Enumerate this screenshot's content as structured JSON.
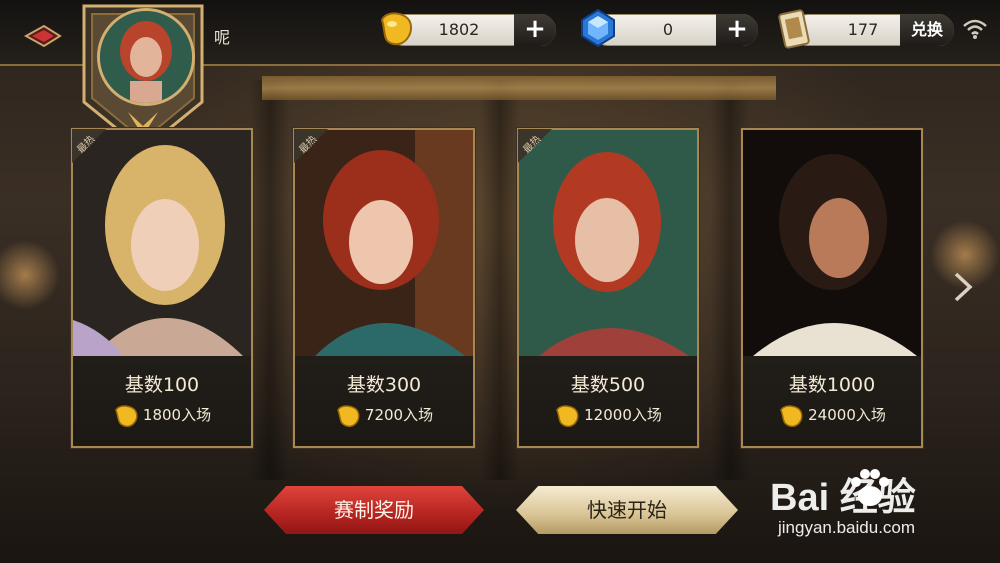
{
  "header": {
    "nickname": "呢",
    "coins": "1802",
    "gems": "0",
    "tickets": "177",
    "exchange_label": "兑换",
    "plus_label": "+"
  },
  "tiers": [
    {
      "hot_tag": "最热",
      "base": "基数100",
      "entry": "1800入场"
    },
    {
      "hot_tag": "最热",
      "base": "基数300",
      "entry": "7200入场"
    },
    {
      "hot_tag": "最热",
      "base": "基数500",
      "entry": "12000入场"
    },
    {
      "hot_tag": "",
      "base": "基数1000",
      "entry": "24000入场"
    }
  ],
  "buttons": {
    "rewards": "赛制奖励",
    "quick_start": "快速开始"
  },
  "watermark": {
    "logo": "Bai  经验",
    "url": "jingyan.baidu.com"
  },
  "colors": {
    "gold_accent": "#a78852",
    "red_button": "#c42a24",
    "gold_button": "#e6d7aa"
  }
}
